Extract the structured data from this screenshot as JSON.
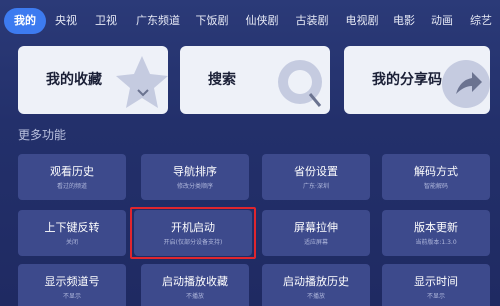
{
  "tabs": [
    {
      "label": "我的",
      "active": true
    },
    {
      "label": "央视"
    },
    {
      "label": "卫视"
    },
    {
      "label": "广东频道"
    },
    {
      "label": "下饭剧"
    },
    {
      "label": "仙侠剧"
    },
    {
      "label": "古装剧"
    },
    {
      "label": "电视剧"
    },
    {
      "label": "电影"
    },
    {
      "label": "动画"
    },
    {
      "label": "综艺"
    }
  ],
  "shortcuts": [
    {
      "label": "我的收藏",
      "icon": "star-icon"
    },
    {
      "label": "搜索",
      "icon": "search-icon"
    },
    {
      "label": "我的分享码",
      "icon": "share-icon"
    }
  ],
  "section_title": "更多功能",
  "cards": [
    {
      "title": "观看历史",
      "sub": "看过的频道"
    },
    {
      "title": "导航排序",
      "sub": "修改分类顺序"
    },
    {
      "title": "省份设置",
      "sub": "广东·深圳"
    },
    {
      "title": "解码方式",
      "sub": "智能解码"
    },
    {
      "title": "上下键反转",
      "sub": "关闭"
    },
    {
      "title": "开机启动",
      "sub": "开启(仅部分设备支持)"
    },
    {
      "title": "屏幕拉伸",
      "sub": "适应屏幕"
    },
    {
      "title": "版本更新",
      "sub": "当前版本:1.3.0"
    },
    {
      "title": "显示频道号",
      "sub": "不显示"
    },
    {
      "title": "启动播放收藏",
      "sub": "不播放"
    },
    {
      "title": "启动播放历史",
      "sub": "不播放"
    },
    {
      "title": "显示时间",
      "sub": "不显示"
    }
  ],
  "colors": {
    "background": "#23306b",
    "active_tab": "#3d7bf0",
    "card": "#3d4a8c",
    "focus_border": "#e0262e"
  }
}
